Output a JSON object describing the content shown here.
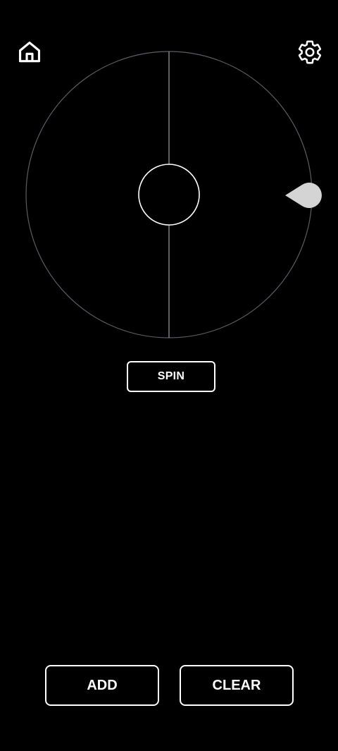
{
  "header": {
    "home_icon": "home-icon",
    "settings_icon": "gear-icon"
  },
  "wheel": {
    "segments": 2,
    "rim_color": "#5a5d66",
    "hub_color": "#ffffff",
    "pointer_color": "#d4d4d4",
    "pointer_side": "right"
  },
  "actions": {
    "spin_label": "SPIN",
    "add_label": "ADD",
    "clear_label": "CLEAR"
  },
  "colors": {
    "background": "#000000",
    "foreground": "#ffffff"
  }
}
